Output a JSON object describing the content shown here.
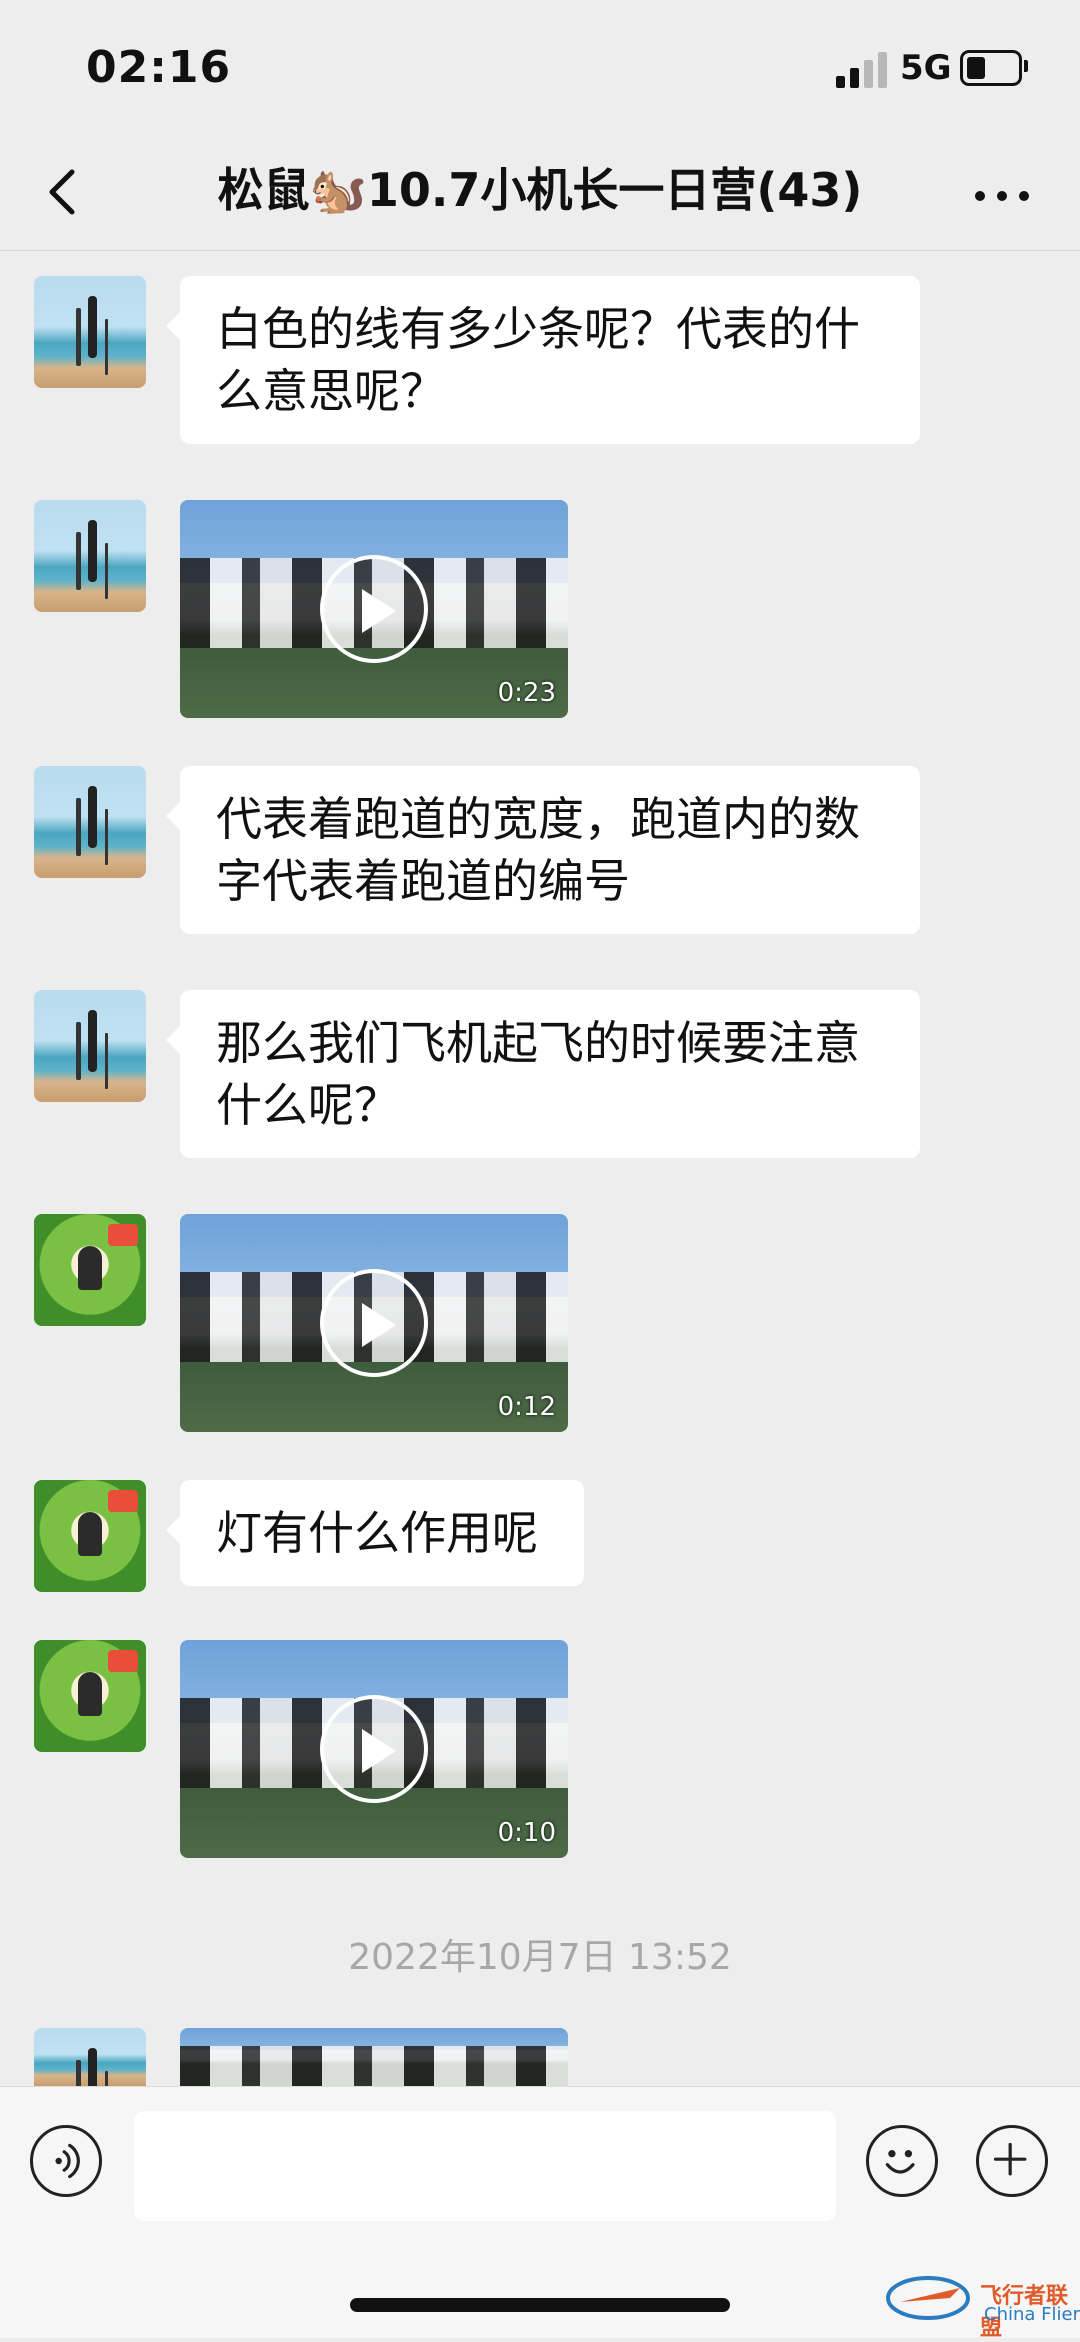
{
  "status": {
    "time": "02:16",
    "network": "5G"
  },
  "header": {
    "title": "松鼠🐿️10.7小机长一日营(43)"
  },
  "messages": [
    {
      "type": "text",
      "avatar": "beach-avatar",
      "text_line1": "白色的线有多少条呢？代表的什",
      "text_line2": "么意思呢？"
    },
    {
      "type": "video",
      "avatar": "beach-avatar",
      "duration": "0:23"
    },
    {
      "type": "text",
      "avatar": "beach-avatar",
      "text_line1": "代表着跑道的宽度，跑道内的数",
      "text_line2": "字代表着跑道的编号"
    },
    {
      "type": "text",
      "avatar": "beach-avatar",
      "text_line1": "那么我们飞机起飞的时候要注意",
      "text_line2": "什么呢？"
    },
    {
      "type": "video",
      "avatar": "green-avatar",
      "duration": "0:12"
    },
    {
      "type": "text",
      "avatar": "green-avatar",
      "text_line1": "灯有什么作用呢"
    },
    {
      "type": "video",
      "avatar": "green-avatar",
      "duration": "0:10"
    },
    {
      "type": "video",
      "avatar": "beach-avatar",
      "duration": ""
    }
  ],
  "timestamp": "2022年10月7日 13:52",
  "input": {
    "value": ""
  },
  "watermark": {
    "title": "飞行者联盟",
    "subtitle": "China Flier"
  },
  "colors": {
    "background": "#ededed",
    "bubble": "#ffffff",
    "timestamp": "#a7a7a7"
  },
  "icons": [
    "back-arrow-icon",
    "more-icon",
    "voice-icon",
    "emoji-icon",
    "plus-icon",
    "play-icon"
  ]
}
